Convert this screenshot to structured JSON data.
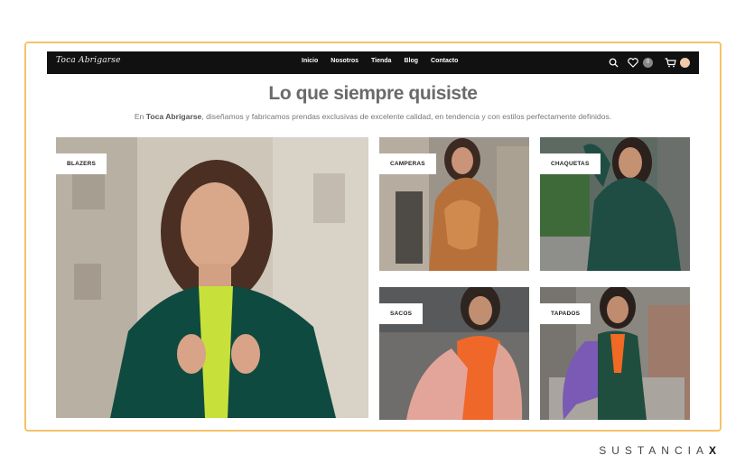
{
  "nav": {
    "logo": "Toca Abrigarse",
    "links": [
      "Inicio",
      "Nosotros",
      "Tienda",
      "Blog",
      "Contacto"
    ],
    "wishlist_count": "0",
    "cart_count": ""
  },
  "hero": {
    "title": "Lo que siempre quisiste",
    "subtitle_prefix": "En",
    "subtitle_brand": "Toca Abrigarse",
    "subtitle_rest": ", diseñamos y fabricamos prendas exclusivas de excelente calidad, en tendencia y con estilos perfectamente definidos."
  },
  "categories": {
    "blazers": "BLAZERS",
    "camperas": "CAMPERAS",
    "chaquetas": "CHAQUETAS",
    "sacos": "SACOS",
    "tapados": "TAPADOS"
  },
  "watermark": {
    "text": "SUSTANCIA",
    "mark": "X"
  },
  "colors": {
    "frame_border": "#f5c36a",
    "navbar_bg": "#111111",
    "headline": "#6a6a6a",
    "tag_bg": "#ffffff"
  },
  "icons": [
    "search-icon",
    "heart-icon",
    "cart-icon"
  ]
}
